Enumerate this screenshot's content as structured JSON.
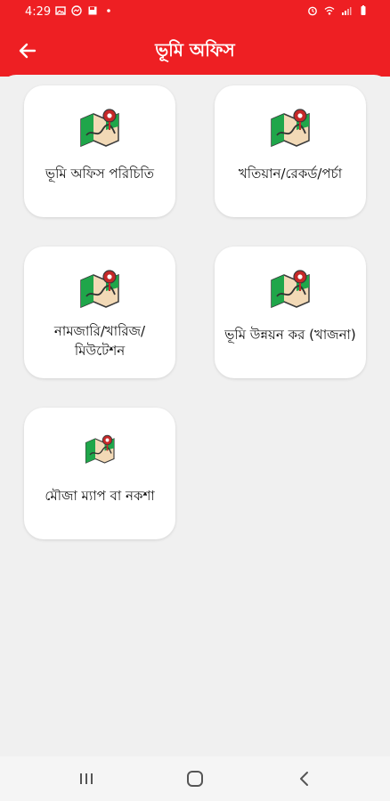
{
  "status_bar": {
    "time": "4:29",
    "left_icons": [
      "image-icon",
      "messenger-icon",
      "save-icon",
      "dot-icon"
    ],
    "right_icons": [
      "alarm-icon",
      "wifi-icon",
      "signal-icon",
      "battery-icon"
    ]
  },
  "app_bar": {
    "title": "ভূমি অফিস",
    "back_icon": "arrow-left-icon"
  },
  "menu": [
    {
      "label": "ভূমি অফিস পরিচিতি",
      "icon": "map-pin-icon"
    },
    {
      "label": "খতিয়ান/রেকর্ড/পর্চা",
      "icon": "map-pin-icon"
    },
    {
      "label_lines": [
        "নামজারি/খারিজ/",
        "মিউটেশন"
      ],
      "icon": "map-pin-icon"
    },
    {
      "label": "ভূমি উন্নয়ন কর (খাজনা)",
      "icon": "map-pin-icon"
    },
    {
      "label": "মৌজা ম্যাপ বা নকশা",
      "icon": "map-pin-icon"
    }
  ],
  "colors": {
    "accent": "#ee1f23",
    "map_green": "#1fa64a",
    "map_paper": "#f2d9b6",
    "pin_red": "#c62828"
  },
  "nav_bar": [
    "recents-icon",
    "home-icon",
    "back-icon"
  ]
}
